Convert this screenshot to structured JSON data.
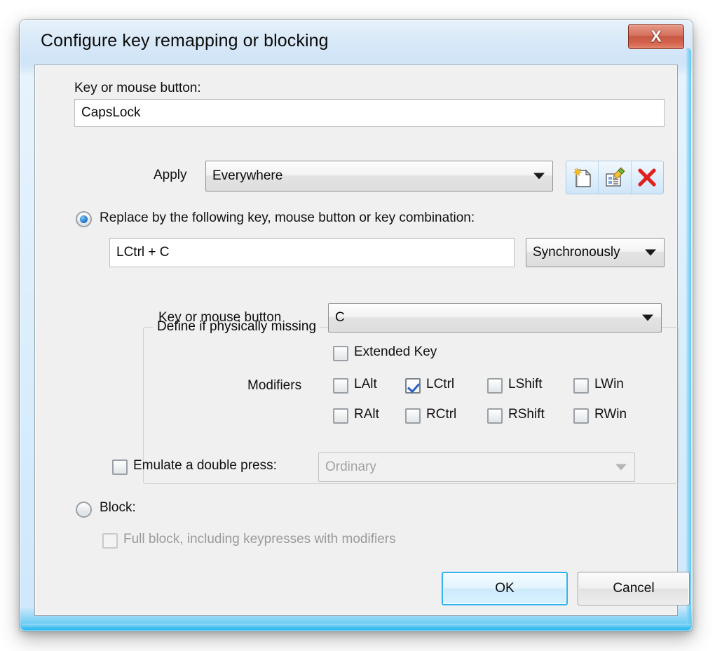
{
  "window": {
    "title": "Configure key remapping or blocking",
    "close_label": "X"
  },
  "form": {
    "key_label": "Key or mouse button:",
    "key_value": "CapsLock",
    "apply_label": "Apply",
    "apply_value": "Everywhere",
    "toolbar": {
      "new_label": "new-item",
      "edit_label": "edit-item",
      "delete_label": "delete-item"
    },
    "replace": {
      "radio_label": "Replace by the following key, mouse button or key combination:",
      "combination_value": "LCtrl + C",
      "mode_value": "Synchronously",
      "selected": true
    },
    "groupbox": {
      "title": "Define if physically missing",
      "key_label": "Key or mouse button",
      "key_value": "C",
      "extended_key_label": "Extended Key",
      "extended_key_checked": false,
      "modifiers_label": "Modifiers",
      "modifiers": [
        {
          "label": "LAlt",
          "checked": false
        },
        {
          "label": "LCtrl",
          "checked": true
        },
        {
          "label": "LShift",
          "checked": false
        },
        {
          "label": "LWin",
          "checked": false
        },
        {
          "label": "RAlt",
          "checked": false
        },
        {
          "label": "RCtrl",
          "checked": false
        },
        {
          "label": "RShift",
          "checked": false
        },
        {
          "label": "RWin",
          "checked": false
        }
      ]
    },
    "emulate": {
      "label": "Emulate a double press:",
      "checked": false,
      "value": "Ordinary",
      "disabled": true
    },
    "block": {
      "radio_label": "Block:",
      "selected": false,
      "full_block_label": "Full block, including keypresses with modifiers",
      "full_block_checked": false,
      "full_block_disabled": true
    }
  },
  "buttons": {
    "ok": "OK",
    "cancel": "Cancel"
  },
  "colors": {
    "accent": "#2fb2ee",
    "close_red": "#c55843",
    "check_blue": "#2761c4",
    "frame_cyan": "#4cc3f2"
  }
}
